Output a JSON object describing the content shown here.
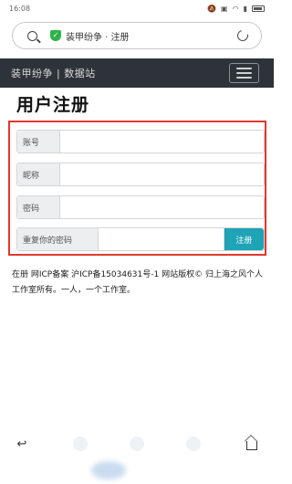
{
  "status_bar": {
    "time": "16:08"
  },
  "browser": {
    "url": "装甲纷争 · 注册",
    "search_icon": "search-icon",
    "secure_icon": "shield-check-icon",
    "reload_icon": "reload-icon"
  },
  "navbar": {
    "brand": "装甲纷争 | 数据站",
    "menu_icon": "hamburger-menu-icon"
  },
  "page": {
    "title": "用户注册"
  },
  "form": {
    "fields": [
      {
        "label": "账号",
        "value": "",
        "placeholder": ""
      },
      {
        "label": "昵称",
        "value": "",
        "placeholder": ""
      },
      {
        "label": "密码",
        "value": "",
        "placeholder": ""
      },
      {
        "label": "重复你的密码",
        "value": "",
        "placeholder": ""
      }
    ],
    "submit_label": "注册",
    "panel_border_color": "#e0392b",
    "submit_color": "#1ea3b7"
  },
  "footer": {
    "text": "在册 网ICP备案 沪ICP备15034631号-1 网站版权© 归上海之风个人工作室所有。一人，一个工作室。"
  },
  "bottom_nav": {
    "back_icon": "back-icon",
    "home_icon": "home-icon"
  }
}
